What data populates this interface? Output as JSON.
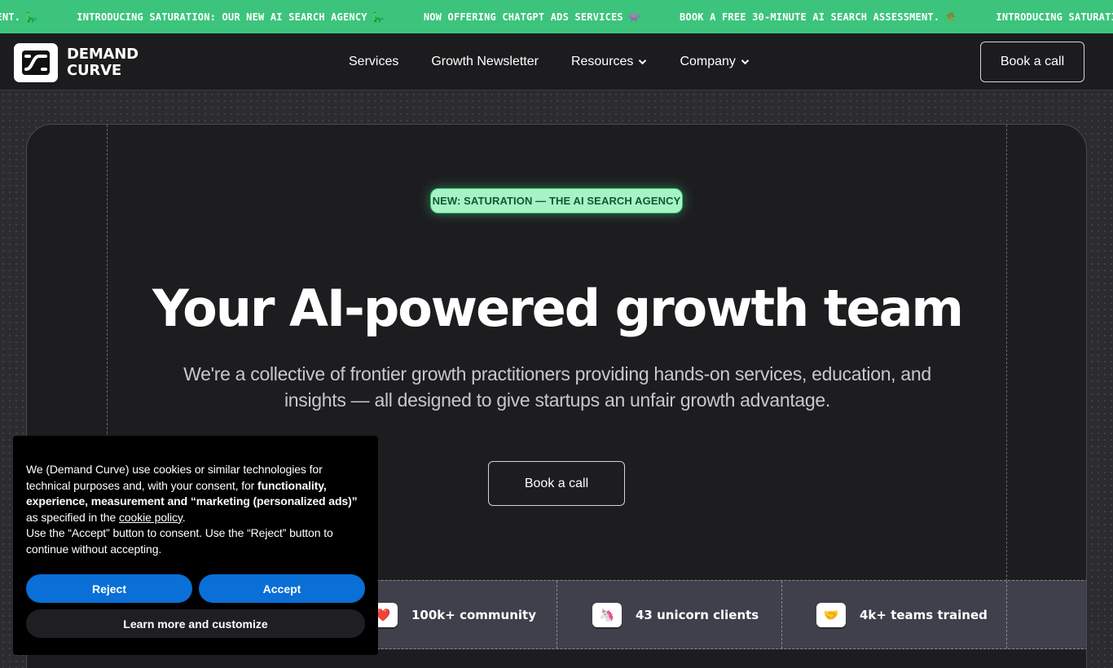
{
  "ticker": {
    "items": [
      {
        "text": "MENT.",
        "emoji": "🦕"
      },
      {
        "text": "INTRODUCING SATURATION: OUR NEW AI SEARCH AGENCY",
        "emoji": "🦕"
      },
      {
        "text": "NOW OFFERING CHATGPT ADS SERVICES",
        "emoji": "👾"
      },
      {
        "text": "BOOK A FREE 30-MINUTE AI SEARCH ASSESSMENT.",
        "emoji": "🌴"
      },
      {
        "text": "INTRODUCING SATURATION: OUR NEW AI SEARCH AGENCY",
        "emoji": "🦕"
      }
    ]
  },
  "nav": {
    "logo_line1": "DEMAND",
    "logo_line2": "CURVE",
    "links": [
      {
        "label": "Services",
        "dropdown": false
      },
      {
        "label": "Growth Newsletter",
        "dropdown": false
      },
      {
        "label": "Resources",
        "dropdown": true
      },
      {
        "label": "Company",
        "dropdown": true
      }
    ],
    "cta": "Book a call"
  },
  "hero": {
    "pill": "NEW: SATURATION — THE AI SEARCH AGENCY",
    "title": "Your AI-powered growth team",
    "subtitle": "We're a collective of frontier growth practitioners providing hands-on services, education, and insights — all designed to give startups an unfair growth advantage.",
    "cta": "Book a call"
  },
  "stats": [
    {
      "emoji": "❤️",
      "icon": "heart-icon",
      "label": "100k+ community"
    },
    {
      "emoji": "🦄",
      "icon": "unicorn-icon",
      "label": "43 unicorn clients"
    },
    {
      "emoji": "🤝",
      "icon": "handshake-icon",
      "label": "4k+ teams trained"
    }
  ],
  "cookie": {
    "text1": "We (Demand Curve) use cookies or similar technologies for technical purposes and, with your consent, for ",
    "text_bold": "functionality, experience, measurement and “marketing (personalized ads)”",
    "text2": " as specified in the ",
    "link": "cookie policy",
    "text3": ".",
    "text4": "Use the “Accept” button to consent. Use the “Reject” button to continue without accepting.",
    "reject": "Reject",
    "accept": "Accept",
    "learn_more": "Learn more and customize"
  },
  "colors": {
    "ticker_bg": "#3cc47c",
    "nav_bg": "#1c1c1e",
    "hero_bg": "#1d1d20",
    "pill_bg": "#a6f4c5",
    "button_blue": "#0a6fd6"
  }
}
